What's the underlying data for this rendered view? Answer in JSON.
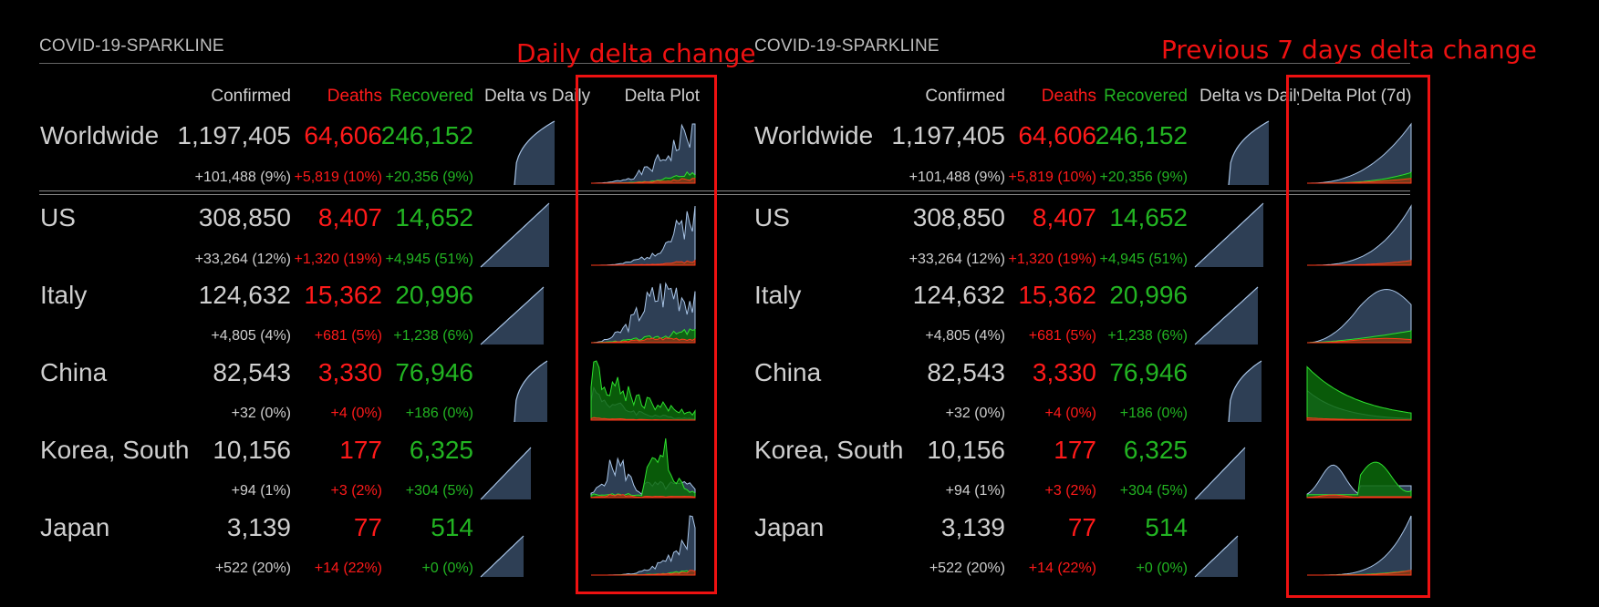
{
  "panels": [
    {
      "title": "COVID-19-SPARKLINE",
      "headers": {
        "confirmed": "Confirmed",
        "deaths": "Deaths",
        "recovered": "Recovered",
        "delta_vs_daily": "Delta vs Daily",
        "delta_plot": "Delta Plot"
      },
      "annotation": "Daily delta change"
    },
    {
      "title": "COVID-19-SPARKLINE",
      "headers": {
        "confirmed": "Confirmed",
        "deaths": "Deaths",
        "recovered": "Recovered",
        "delta_vs_daily": "Delta vs Daily",
        "delta_plot": "Delta Plot (7d)"
      },
      "annotation": "Previous 7 days delta change"
    }
  ],
  "rows": [
    {
      "name": "Worldwide",
      "confirmed": "1,197,405",
      "deaths": "64,606",
      "recovered": "246,152",
      "confirmed_delta": "+101,488 (9%)",
      "deaths_delta": "+5,819 (10%)",
      "recovered_delta": "+20,356 (9%)"
    },
    {
      "name": "US",
      "confirmed": "308,850",
      "deaths": "8,407",
      "recovered": "14,652",
      "confirmed_delta": "+33,264 (12%)",
      "deaths_delta": "+1,320 (19%)",
      "recovered_delta": "+4,945 (51%)"
    },
    {
      "name": "Italy",
      "confirmed": "124,632",
      "deaths": "15,362",
      "recovered": "20,996",
      "confirmed_delta": "+4,805 (4%)",
      "deaths_delta": "+681 (5%)",
      "recovered_delta": "+1,238 (6%)"
    },
    {
      "name": "China",
      "confirmed": "82,543",
      "deaths": "3,330",
      "recovered": "76,946",
      "confirmed_delta": "+32 (0%)",
      "deaths_delta": "+4 (0%)",
      "recovered_delta": "+186 (0%)"
    },
    {
      "name": "Korea, South",
      "confirmed": "10,156",
      "deaths": "177",
      "recovered": "6,325",
      "confirmed_delta": "+94 (1%)",
      "deaths_delta": "+3 (2%)",
      "recovered_delta": "+304 (5%)"
    },
    {
      "name": "Japan",
      "confirmed": "3,139",
      "deaths": "77",
      "recovered": "514",
      "confirmed_delta": "+522 (20%)",
      "deaths_delta": "+14 (22%)",
      "recovered_delta": "+0 (0%)"
    }
  ],
  "colors": {
    "confirmed": "#cfcfcf",
    "deaths": "#ff1a1a",
    "recovered": "#22b422",
    "spark_fill": "#2e3f55",
    "spark_line": "#a8c4e6",
    "annotation": "#ee1111"
  }
}
